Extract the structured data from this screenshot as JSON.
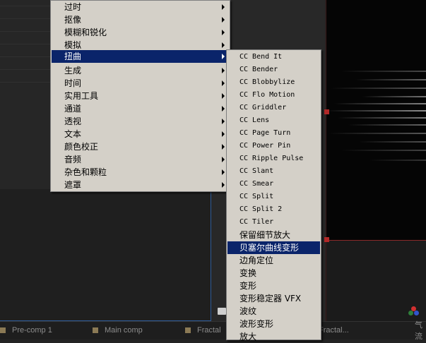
{
  "effect_menu": {
    "items": [
      {
        "label": "过时",
        "has_submenu": true
      },
      {
        "label": "抠像",
        "has_submenu": true
      },
      {
        "label": "模糊和锐化",
        "has_submenu": true
      },
      {
        "label": "模拟",
        "has_submenu": true
      },
      {
        "label": "扭曲",
        "has_submenu": true,
        "selected": true
      },
      {
        "label": "生成",
        "has_submenu": true
      },
      {
        "label": "时间",
        "has_submenu": true
      },
      {
        "label": "实用工具",
        "has_submenu": true
      },
      {
        "label": "通道",
        "has_submenu": true
      },
      {
        "label": "透视",
        "has_submenu": true
      },
      {
        "label": "文本",
        "has_submenu": true
      },
      {
        "label": "颜色校正",
        "has_submenu": true
      },
      {
        "label": "音频",
        "has_submenu": true
      },
      {
        "label": "杂色和颗粒",
        "has_submenu": true
      },
      {
        "label": "遮罩",
        "has_submenu": true
      }
    ]
  },
  "distort_submenu": {
    "items": [
      {
        "label": "CC Bend It"
      },
      {
        "label": "CC Bender"
      },
      {
        "label": "CC Blobbylize"
      },
      {
        "label": "CC Flo Motion"
      },
      {
        "label": "CC Griddler"
      },
      {
        "label": "CC Lens"
      },
      {
        "label": "CC Page Turn"
      },
      {
        "label": "CC Power Pin"
      },
      {
        "label": "CC Ripple Pulse"
      },
      {
        "label": "CC Slant"
      },
      {
        "label": "CC Smear"
      },
      {
        "label": "CC Split"
      },
      {
        "label": "CC Split 2"
      },
      {
        "label": "CC Tiler"
      },
      {
        "label": "保留细节放大"
      },
      {
        "label": "贝塞尔曲线变形",
        "selected": true
      },
      {
        "label": "边角定位"
      },
      {
        "label": "变换"
      },
      {
        "label": "变形"
      },
      {
        "label": "变形稳定器 VFX"
      },
      {
        "label": "波纹"
      },
      {
        "label": "波形变形"
      },
      {
        "label": "放大"
      }
    ]
  },
  "bottom_tabs": [
    {
      "label": "Pre-comp 1",
      "color": "#8b7a55"
    },
    {
      "label": "Main comp",
      "color": "#8b7a55"
    },
    {
      "label": "Fractal",
      "color": "#8b7a55"
    },
    {
      "label": "Fractal..."
    },
    {
      "label": "气流"
    }
  ],
  "colors": {
    "menu_bg": "#d4d0c8",
    "menu_highlight": "#0a246a",
    "panel_border": "#2f5c9a",
    "handle": "#b02828"
  }
}
